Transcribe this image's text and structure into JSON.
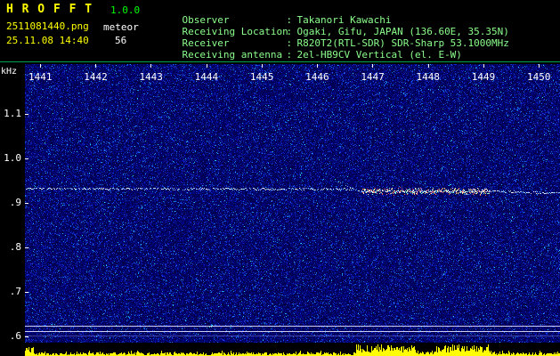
{
  "header": {
    "app_title": "H R O F F T",
    "version": "1.0.0",
    "filename": "2511081440.png",
    "datetime": "25.11.08 14:40",
    "mode_label": "meteor",
    "count": "56",
    "separator": ":",
    "info_rows": [
      {
        "label": "Observer",
        "value": "Takanori Kawachi"
      },
      {
        "label": "Receiving Location",
        "value": "Ogaki, Gifu, JAPAN (136.60E, 35.35N)"
      },
      {
        "label": "Receiver",
        "value": "R820T2(RTL-SDR) SDR-Sharp 53.1000MHz"
      },
      {
        "label": "Receiving antenna",
        "value": "2el-HB9CV Vertical (el. E-W)"
      }
    ]
  },
  "spectrogram": {
    "y_axis_label": "kHz",
    "y_ticks": [
      {
        "label": "1.1",
        "freq": 1.1
      },
      {
        "label": "1.0",
        "freq": 1.0
      },
      {
        "label": ".9",
        "freq": 0.9
      },
      {
        "label": ".8",
        "freq": 0.8
      },
      {
        "label": ".7",
        "freq": 0.7
      },
      {
        "label": ".6",
        "freq": 0.6
      }
    ],
    "x_ticks": [
      "1441",
      "1442",
      "1443",
      "1444",
      "1445",
      "1446",
      "1447",
      "1448",
      "1449",
      "1450"
    ],
    "trace": {
      "baseline_khz": 0.933,
      "echo_khz": 0.927,
      "echo_start_min": 1446.8,
      "echo_end_min": 1449.1
    },
    "colors": {
      "noise_base": "#00005a",
      "trace": "#9cc8ff",
      "activity": "#ffff00",
      "echo_hot": [
        "#ffffff",
        "#ffe878",
        "#ff8080",
        "#80ffd0"
      ]
    }
  }
}
